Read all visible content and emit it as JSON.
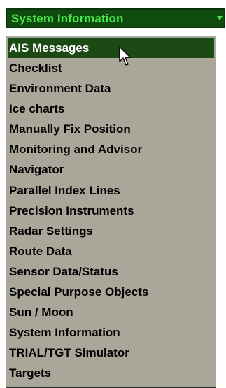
{
  "combo": {
    "selected_value": "System Information",
    "arrow_icon": "chevron-down-icon"
  },
  "dropdown": {
    "selected_index": 0,
    "items": [
      {
        "label": "AIS Messages"
      },
      {
        "label": "Checklist"
      },
      {
        "label": "Environment Data"
      },
      {
        "label": "Ice charts"
      },
      {
        "label": "Manually Fix Position"
      },
      {
        "label": "Monitoring and Advisor"
      },
      {
        "label": "Navigator"
      },
      {
        "label": "Parallel Index Lines"
      },
      {
        "label": "Precision Instruments"
      },
      {
        "label": "Radar Settings"
      },
      {
        "label": "Route Data"
      },
      {
        "label": "Sensor Data/Status"
      },
      {
        "label": "Special Purpose Objects"
      },
      {
        "label": "Sun / Moon"
      },
      {
        "label": "System Information"
      },
      {
        "label": "TRIAL/TGT Simulator"
      },
      {
        "label": "Targets"
      }
    ]
  },
  "cursor": {
    "icon": "mouse-pointer-icon"
  },
  "colors": {
    "combo_background": "#0f4a0f",
    "combo_text": "#48e848",
    "list_background": "#aaa69a",
    "selected_background": "#1c4a14",
    "selected_text": "#ffffff",
    "item_text": "#000000"
  }
}
